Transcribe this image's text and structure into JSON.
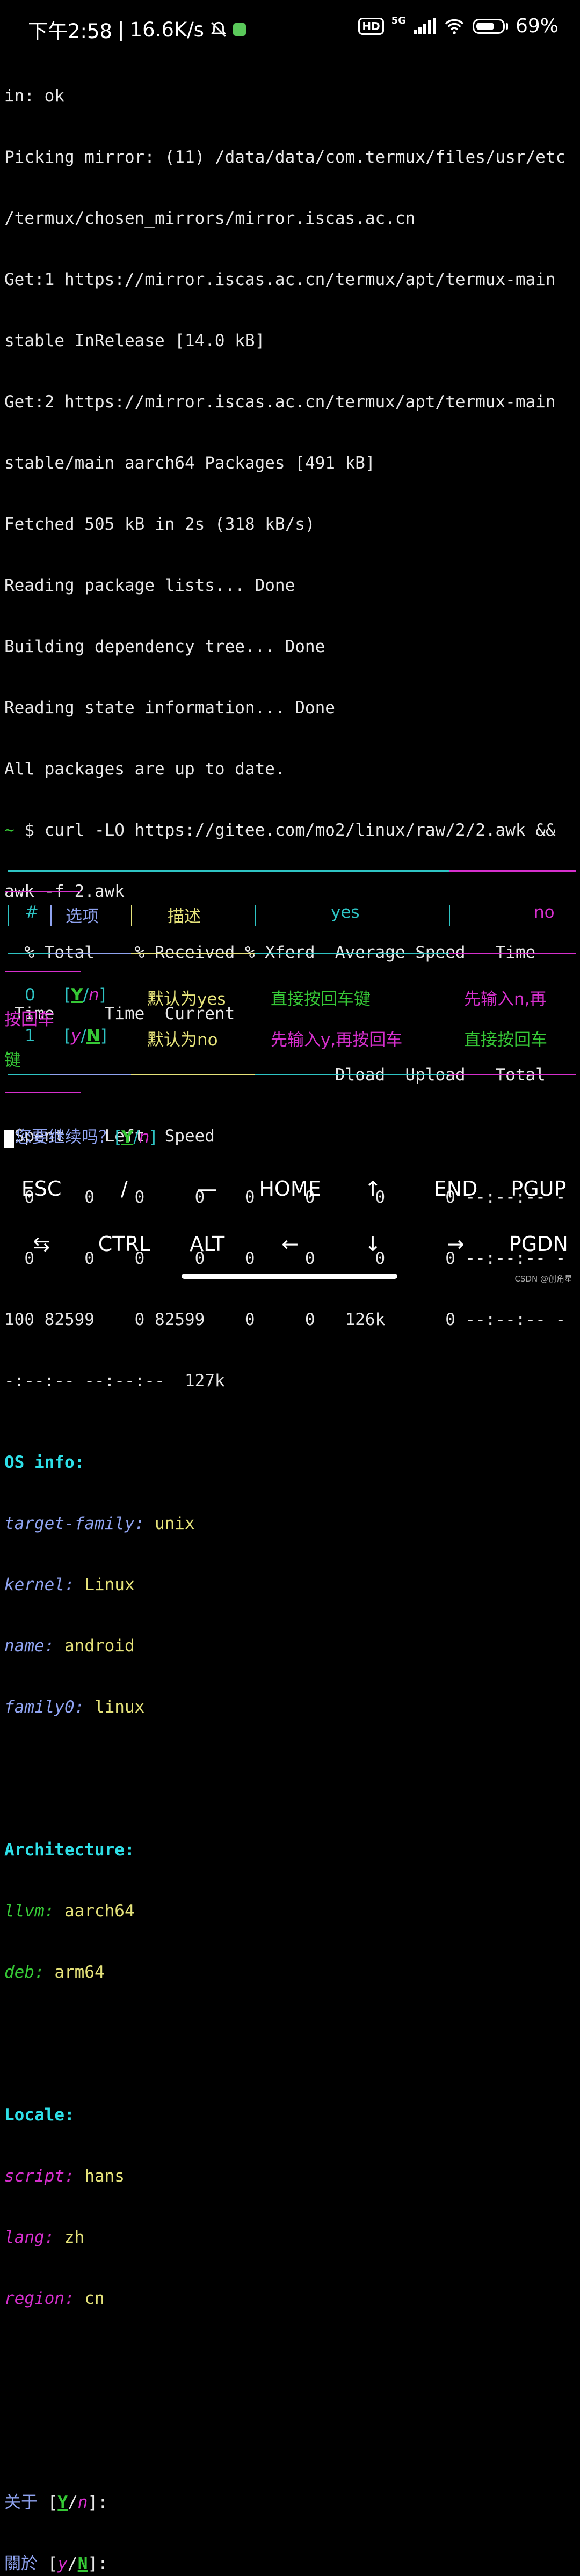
{
  "status_bar": {
    "time": "下午2:58",
    "speed": "16.6K/s",
    "network": "5G",
    "battery": "69%",
    "hd_label": "HD",
    "icons": [
      "mute-bell-icon",
      "app-notification-icon",
      "hd-icon",
      "signal-icon",
      "wifi-icon",
      "battery-icon"
    ]
  },
  "terminal": {
    "lines": [
      "in: ok",
      "Picking mirror: (11) /data/data/com.termux/files/usr/etc",
      "/termux/chosen_mirrors/mirror.iscas.ac.cn",
      "Get:1 https://mirror.iscas.ac.cn/termux/apt/termux-main",
      "stable InRelease [14.0 kB]",
      "Get:2 https://mirror.iscas.ac.cn/termux/apt/termux-main",
      "stable/main aarch64 Packages [491 kB]",
      "Fetched 505 kB in 2s (318 kB/s)",
      "Reading package lists... Done",
      "Building dependency tree... Done",
      "Reading state information... Done",
      "All packages are up to date."
    ],
    "prompt_symbol": "~",
    "prompt_cmd": " $ curl -LO https://gitee.com/mo2/linux/raw/2/2.awk &&",
    "prompt_cmd_cont": "awk -f 2.awk",
    "curl_lines": [
      "  % Total    % Received % Xferd  Average Speed   Time",
      " Time     Time  Current",
      "                                 Dload  Upload   Total",
      " Spent    Left  Speed",
      "  0     0    0     0    0     0      0      0 --:--:-- -",
      "  0     0    0     0    0     0      0      0 --:--:-- -",
      "100 82599    0 82599    0     0   126k      0 --:--:-- -",
      "-:--:-- --:--:--  127k"
    ],
    "os_info": {
      "heading": "OS info:",
      "items": [
        {
          "key": "target-family:",
          "value": " unix"
        },
        {
          "key": "kernel:",
          "value": " Linux"
        },
        {
          "key": "name:",
          "value": " android"
        },
        {
          "key": "family0:",
          "value": " linux"
        }
      ]
    },
    "architecture": {
      "heading": "Architecture:",
      "items": [
        {
          "key": "llvm:",
          "value": " aarch64"
        },
        {
          "key": "deb:",
          "value": " arm64"
        }
      ]
    },
    "locale": {
      "heading": "Locale:",
      "items": [
        {
          "key": "script:",
          "value": " hans"
        },
        {
          "key": "lang:",
          "value": " zh"
        },
        {
          "key": "region:",
          "value": " cn"
        }
      ]
    },
    "about1": {
      "label": "关于 ",
      "open": "[",
      "y": "Y",
      "slash": "/",
      "n": "n",
      "close": "]",
      "colon": ":"
    },
    "about2": {
      "label": "關於 ",
      "open": "[",
      "y": "y",
      "slash": "/",
      "n": "N",
      "close": "]",
      "colon": ":"
    }
  },
  "table": {
    "headers": [
      "#",
      "选项",
      "描述",
      "yes",
      "no"
    ],
    "rows": [
      {
        "num": "0",
        "opt_open": "[",
        "opt_y": "Y",
        "opt_slash": "/",
        "opt_n": "n",
        "opt_close": "]",
        "desc": "默认为yes",
        "yes": "直接按回车键",
        "no": "先输入n,再",
        "no_cont": "按回车"
      },
      {
        "num": "1",
        "opt_open": "[",
        "opt_y": "y",
        "opt_slash": "/",
        "opt_n": "N",
        "opt_close": "]",
        "desc": "默认为no",
        "yes": "先输入y,再按回车",
        "no": "直接按回车",
        "no_cont": "键"
      }
    ]
  },
  "confirm": {
    "question": "您要继续吗？",
    "open": "[",
    "y": "Y",
    "slash": "/",
    "n": "n",
    "close": "]"
  },
  "extra_keys": {
    "row1": [
      "ESC",
      "/",
      "—",
      "HOME",
      "↑",
      "END",
      "PGUP"
    ],
    "row2": [
      "⇆",
      "CTRL",
      "ALT",
      "←",
      "↓",
      "→",
      "PGDN"
    ]
  },
  "watermark": "CSDN @创角星",
  "colors": {
    "background": "#000000",
    "cyan": "#2ee0e8",
    "blue": "#8fa3f0",
    "yellow": "#e5e27a",
    "magenta": "#d62fcd",
    "green": "#36c836"
  }
}
